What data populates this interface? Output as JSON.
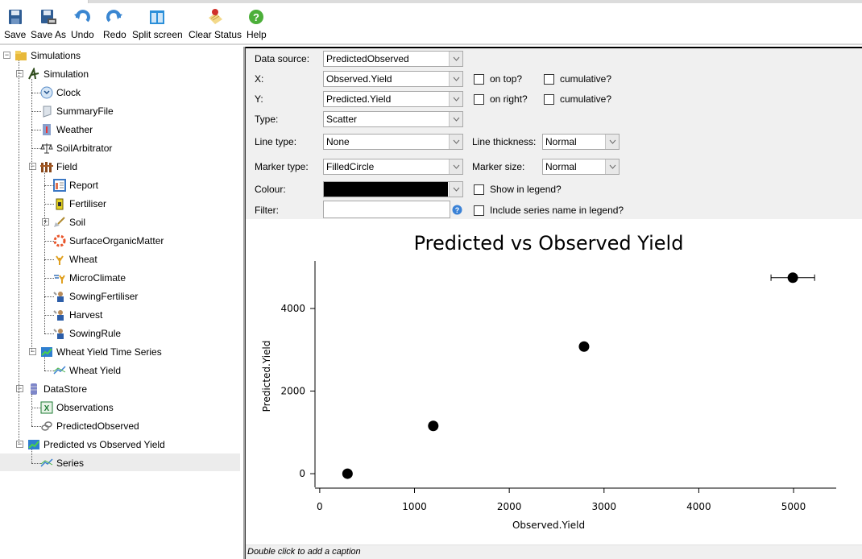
{
  "toolbar": {
    "buttons": [
      {
        "label": "Save",
        "icon": "save-icon"
      },
      {
        "label": "Save As",
        "icon": "save-as-icon"
      },
      {
        "label": "Undo",
        "icon": "undo-icon"
      },
      {
        "label": "Redo",
        "icon": "redo-icon"
      },
      {
        "label": "Split screen",
        "icon": "split-screen-icon"
      },
      {
        "label": "Clear Status",
        "icon": "clear-status-icon"
      },
      {
        "label": "Help",
        "icon": "help-icon"
      }
    ]
  },
  "tree": {
    "nodes": [
      {
        "label": "Simulations",
        "icon": "simulations-folder-icon",
        "expander": "−"
      },
      {
        "label": "Simulation",
        "icon": "simulation-icon",
        "expander": "−"
      },
      {
        "label": "Clock",
        "icon": "clock-icon"
      },
      {
        "label": "SummaryFile",
        "icon": "summary-file-icon"
      },
      {
        "label": "Weather",
        "icon": "weather-icon"
      },
      {
        "label": "SoilArbitrator",
        "icon": "scales-icon"
      },
      {
        "label": "Field",
        "icon": "field-fence-icon",
        "expander": "−"
      },
      {
        "label": "Report",
        "icon": "report-icon"
      },
      {
        "label": "Fertiliser",
        "icon": "fertiliser-icon"
      },
      {
        "label": "Soil",
        "icon": "soil-shovel-icon",
        "expander": "+"
      },
      {
        "label": "SurfaceOrganicMatter",
        "icon": "surface-organic-matter-icon"
      },
      {
        "label": "Wheat",
        "icon": "wheat-icon"
      },
      {
        "label": "MicroClimate",
        "icon": "microclimate-icon"
      },
      {
        "label": "SowingFertiliser",
        "icon": "manager-icon"
      },
      {
        "label": "Harvest",
        "icon": "manager-icon"
      },
      {
        "label": "SowingRule",
        "icon": "manager-icon"
      },
      {
        "label": "Wheat Yield Time Series",
        "icon": "graph-icon",
        "expander": "−"
      },
      {
        "label": "Wheat Yield",
        "icon": "series-icon"
      },
      {
        "label": "DataStore",
        "icon": "datastore-icon",
        "expander": "−"
      },
      {
        "label": "Observations",
        "icon": "excel-icon"
      },
      {
        "label": "PredictedObserved",
        "icon": "link-icon"
      },
      {
        "label": "Predicted vs Observed Yield",
        "icon": "graph-icon",
        "expander": "−"
      },
      {
        "label": "Series",
        "icon": "series-icon",
        "selected": true
      }
    ]
  },
  "props": {
    "data_source_label": "Data source:",
    "data_source_value": "PredictedObserved",
    "x_label": "X:",
    "x_value": "Observed.Yield",
    "y_label": "Y:",
    "y_value": "Predicted.Yield",
    "type_label": "Type:",
    "type_value": "Scatter",
    "line_type_label": "Line type:",
    "line_type_value": "None",
    "line_thickness_label": "Line thickness:",
    "line_thickness_value": "Normal",
    "marker_type_label": "Marker type:",
    "marker_type_value": "FilledCircle",
    "marker_size_label": "Marker size:",
    "marker_size_value": "Normal",
    "colour_label": "Colour:",
    "colour_value": "#000000",
    "filter_label": "Filter:",
    "filter_value": "",
    "on_top_label": "on top?",
    "on_top_checked": false,
    "x_cumulative_label": "cumulative?",
    "x_cumulative_checked": false,
    "on_right_label": "on right?",
    "on_right_checked": false,
    "y_cumulative_label": "cumulative?",
    "y_cumulative_checked": false,
    "show_in_legend_label": "Show in legend?",
    "show_in_legend_checked": false,
    "include_series_name_label": "Include series name in legend?",
    "include_series_name_checked": false
  },
  "caption": "Double click to add a caption",
  "chart_data": {
    "type": "scatter",
    "title": "Predicted vs Observed Yield",
    "xlabel": "Observed.Yield",
    "ylabel": "Predicted.Yield",
    "xlim": [
      -50,
      5450
    ],
    "ylim": [
      -330,
      5150
    ],
    "xticks": [
      0,
      1000,
      2000,
      3000,
      4000,
      5000
    ],
    "yticks": [
      0,
      2000,
      4000
    ],
    "grid": false,
    "legend": "none",
    "marker": "filled-circle",
    "color": "#000000",
    "series": [
      {
        "name": "Series",
        "x": [
          293,
          1198,
          2789,
          4992
        ],
        "y": [
          0,
          1157,
          3078,
          4745
        ],
        "x_error": [
          0,
          40,
          0,
          230
        ]
      }
    ]
  }
}
